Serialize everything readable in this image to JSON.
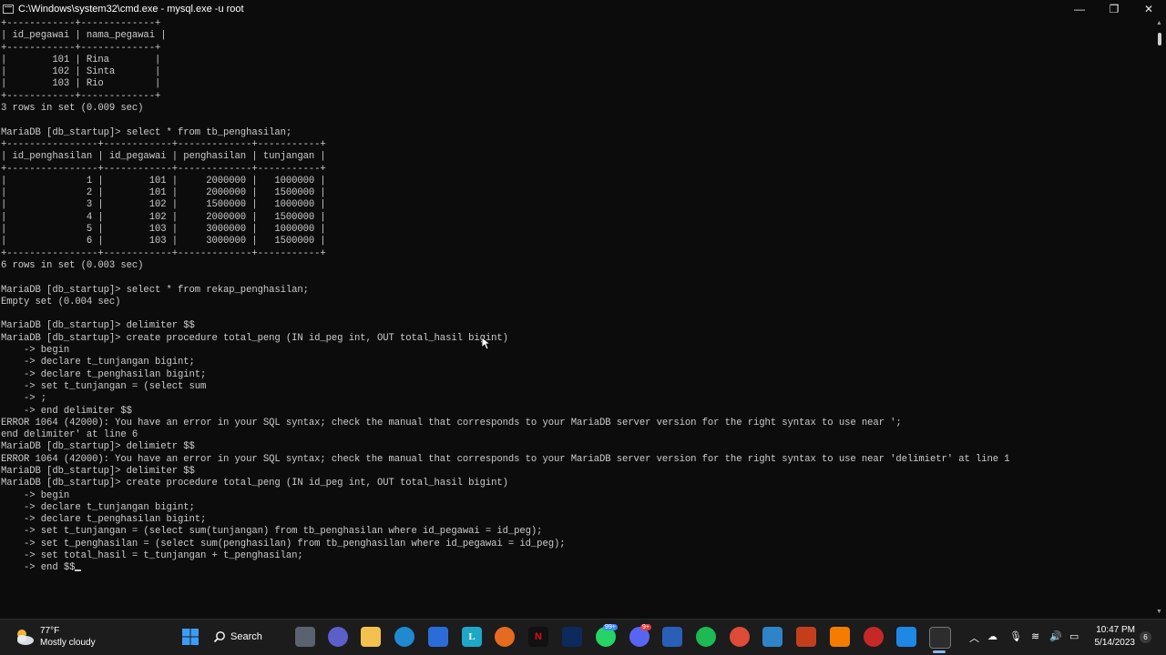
{
  "window": {
    "title": "C:\\Windows\\system32\\cmd.exe - mysql.exe  -u root",
    "minimize_glyph": "—",
    "maximize_glyph": "❐",
    "close_glyph": "✕"
  },
  "console_lines": [
    "+------------+-------------+",
    "| id_pegawai | nama_pegawai |",
    "+------------+-------------+",
    "|        101 | Rina        |",
    "|        102 | Sinta       |",
    "|        103 | Rio         |",
    "+------------+-------------+",
    "3 rows in set (0.009 sec)",
    "",
    "MariaDB [db_startup]> select * from tb_penghasilan;",
    "+----------------+------------+-------------+-----------+",
    "| id_penghasilan | id_pegawai | penghasilan | tunjangan |",
    "+----------------+------------+-------------+-----------+",
    "|              1 |        101 |     2000000 |   1000000 |",
    "|              2 |        101 |     2000000 |   1500000 |",
    "|              3 |        102 |     1500000 |   1000000 |",
    "|              4 |        102 |     2000000 |   1500000 |",
    "|              5 |        103 |     3000000 |   1000000 |",
    "|              6 |        103 |     3000000 |   1500000 |",
    "+----------------+------------+-------------+-----------+",
    "6 rows in set (0.003 sec)",
    "",
    "MariaDB [db_startup]> select * from rekap_penghasilan;",
    "Empty set (0.004 sec)",
    "",
    "MariaDB [db_startup]> delimiter $$",
    "MariaDB [db_startup]> create procedure total_peng (IN id_peg int, OUT total_hasil bigint)",
    "    -> begin",
    "    -> declare t_tunjangan bigint;",
    "    -> declare t_penghasilan bigint;",
    "    -> set t_tunjangan = (select sum",
    "    -> ;",
    "    -> end delimiter $$",
    "ERROR 1064 (42000): You have an error in your SQL syntax; check the manual that corresponds to your MariaDB server version for the right syntax to use near ';",
    "end delimiter' at line 6",
    "MariaDB [db_startup]> delimietr $$",
    "ERROR 1064 (42000): You have an error in your SQL syntax; check the manual that corresponds to your MariaDB server version for the right syntax to use near 'delimietr' at line 1",
    "MariaDB [db_startup]> delimiter $$",
    "MariaDB [db_startup]> create procedure total_peng (IN id_peg int, OUT total_hasil bigint)",
    "    -> begin",
    "    -> declare t_tunjangan bigint;",
    "    -> declare t_penghasilan bigint;",
    "    -> set t_tunjangan = (select sum(tunjangan) from tb_penghasilan where id_pegawai = id_peg);",
    "    -> set t_penghasilan = (select sum(penghasilan) from tb_penghasilan where id_pegawai = id_peg);",
    "    -> set total_hasil = t_tunjangan + t_penghasilan;",
    "    -> end $$"
  ],
  "taskbar": {
    "weather_temp": "77°F",
    "weather_desc": "Mostly cloudy",
    "search_label": "Search",
    "badge_whatsapp": "99+",
    "badge_discord": "9+",
    "time": "10:47 PM",
    "date": "5/14/2023",
    "notification_count": "6"
  },
  "colors": {
    "console_bg": "#0c0c0c",
    "console_fg": "#cccccc",
    "taskbar_bg": "#1c1c1c"
  }
}
